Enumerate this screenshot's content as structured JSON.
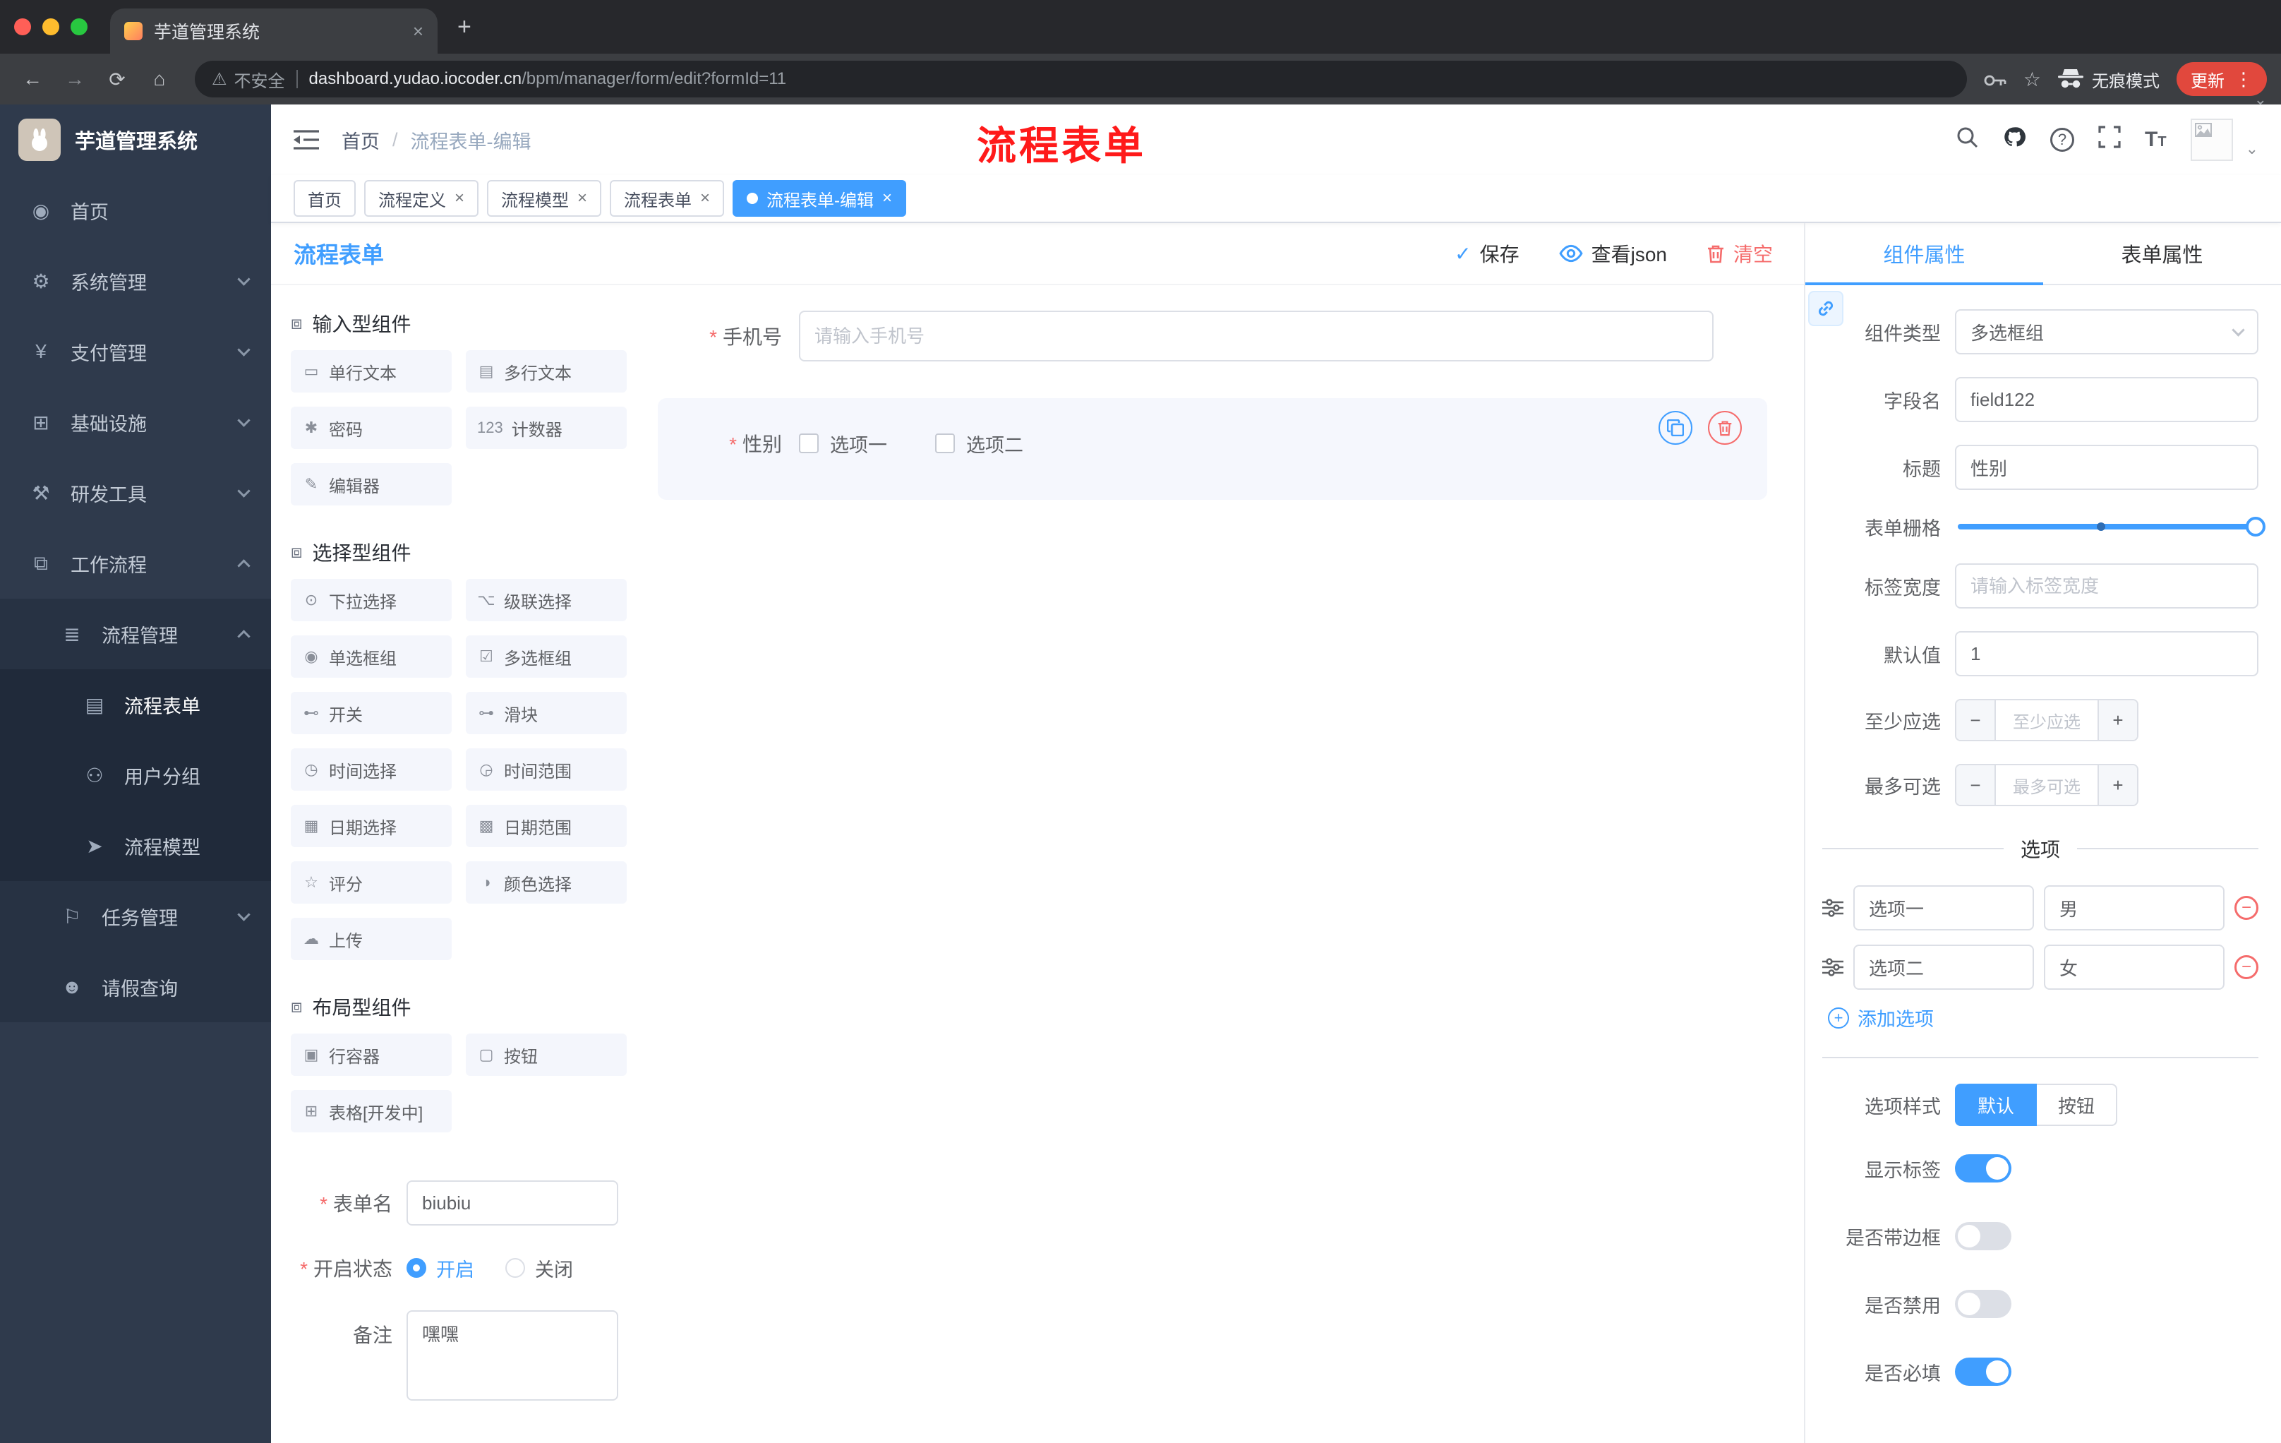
{
  "glyphs": {
    "close": "×",
    "plus": "+",
    "dots": "⋮",
    "minus": "−",
    "check": "✓",
    "caret": "⌄",
    "question": "?",
    "back": "←",
    "forward": "→",
    "reload": "⟳",
    "home": "⌂",
    "star": "☆",
    "warning": "⚠",
    "tsize_big": "T",
    "tsize_small": "T",
    "slash": "/"
  },
  "colors": {
    "accent": "#409EFF",
    "danger": "#F56C6C",
    "sidebar_bg": "#2F3A4C",
    "update_pill": "#E1483D"
  },
  "browser": {
    "tab_title": "芋道管理系统",
    "security_label": "不安全",
    "url_domain": "dashboard.yudao.iocoder.cn",
    "url_path": "/bpm/manager/form/edit?formId=11",
    "incognito_label": "无痕模式",
    "update_label": "更新"
  },
  "sidebar": {
    "logo_title": "芋道管理系统",
    "items": [
      {
        "label": "首页",
        "glyph": "◉"
      },
      {
        "label": "系统管理",
        "glyph": "⚙"
      },
      {
        "label": "支付管理",
        "glyph": "¥"
      },
      {
        "label": "基础设施",
        "glyph": "⊞"
      },
      {
        "label": "研发工具",
        "glyph": "⚒"
      },
      {
        "label": "工作流程",
        "glyph": "⧉"
      },
      {
        "label": "流程管理",
        "glyph": "≣"
      },
      {
        "label": "流程表单",
        "glyph": "▤"
      },
      {
        "label": "用户分组",
        "glyph": "⚇"
      },
      {
        "label": "流程模型",
        "glyph": "➤"
      },
      {
        "label": "任务管理",
        "glyph": "⚐"
      },
      {
        "label": "请假查询",
        "glyph": "☻"
      }
    ]
  },
  "header": {
    "breadcrumb_home": "首页",
    "breadcrumb_current": "流程表单-编辑",
    "annotation": "流程表单"
  },
  "tags": [
    {
      "label": "首页"
    },
    {
      "label": "流程定义"
    },
    {
      "label": "流程模型"
    },
    {
      "label": "流程表单"
    },
    {
      "label": "流程表单-编辑"
    }
  ],
  "editor": {
    "page_title": "流程表单",
    "save_label": "保存",
    "view_json_label": "查看json",
    "clear_label": "清空",
    "groups": [
      {
        "title": "输入型组件",
        "glyph": "⧈",
        "items": [
          {
            "label": "单行文本",
            "glyph": "▭"
          },
          {
            "label": "多行文本",
            "glyph": "▤"
          },
          {
            "label": "密码",
            "glyph": "✱"
          },
          {
            "label": "计数器",
            "glyph": "123"
          },
          {
            "label": "编辑器",
            "glyph": "✎"
          }
        ]
      },
      {
        "title": "选择型组件",
        "glyph": "⧈",
        "items": [
          {
            "label": "下拉选择",
            "glyph": "⊙"
          },
          {
            "label": "级联选择",
            "glyph": "⌥"
          },
          {
            "label": "单选框组",
            "glyph": "◉"
          },
          {
            "label": "多选框组",
            "glyph": "☑"
          },
          {
            "label": "开关",
            "glyph": "⊷"
          },
          {
            "label": "滑块",
            "glyph": "⊶"
          },
          {
            "label": "时间选择",
            "glyph": "◷"
          },
          {
            "label": "时间范围",
            "glyph": "◶"
          },
          {
            "label": "日期选择",
            "glyph": "▦"
          },
          {
            "label": "日期范围",
            "glyph": "▩"
          },
          {
            "label": "评分",
            "glyph": "☆"
          },
          {
            "label": "颜色选择",
            "glyph": "◑"
          },
          {
            "label": "上传",
            "glyph": "☁"
          }
        ]
      },
      {
        "title": "布局型组件",
        "glyph": "⧈",
        "items": [
          {
            "label": "行容器",
            "glyph": "▣"
          },
          {
            "label": "按钮",
            "glyph": "▢"
          },
          {
            "label": "表格[开发中]",
            "glyph": "⊞"
          }
        ]
      }
    ],
    "meta": {
      "name_label": "表单名",
      "name_value": "biubiu",
      "status_label": "开启状态",
      "status_on": "开启",
      "status_off": "关闭",
      "remark_label": "备注",
      "remark_value": "嘿嘿"
    },
    "canvas": {
      "phone_label": "手机号",
      "phone_placeholder": "请输入手机号",
      "gender_label": "性别",
      "gender_opt1": "选项一",
      "gender_opt2": "选项二"
    }
  },
  "props": {
    "tab_component": "组件属性",
    "tab_form": "表单属性",
    "component_type_label": "组件类型",
    "component_type_value": "多选框组",
    "field_label": "字段名",
    "field_value": "field122",
    "title_label": "标题",
    "title_value": "性别",
    "grid_label": "表单栅格",
    "label_width_label": "标签宽度",
    "label_width_placeholder": "请输入标签宽度",
    "default_label": "默认值",
    "default_value": "1",
    "min_label": "至少应选",
    "min_placeholder": "至少应选",
    "max_label": "最多可选",
    "max_placeholder": "最多可选",
    "options_title": "选项",
    "options": [
      {
        "name": "选项一",
        "value": "男"
      },
      {
        "name": "选项二",
        "value": "女"
      }
    ],
    "add_option": "添加选项",
    "style_label": "选项样式",
    "style_default": "默认",
    "style_button": "按钮",
    "show_label": "显示标签",
    "border_label": "是否带边框",
    "disabled_label": "是否禁用",
    "required_label": "是否必填"
  }
}
